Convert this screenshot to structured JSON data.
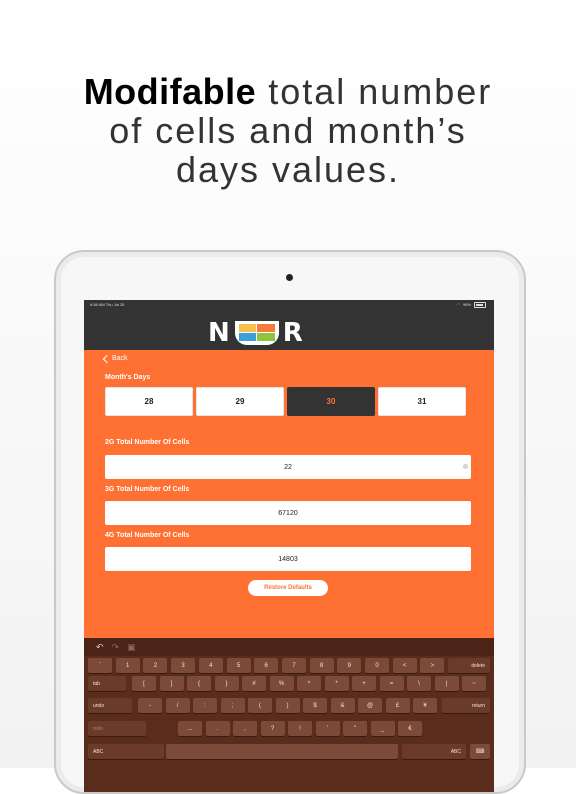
{
  "headline": {
    "bold": "Modifable",
    "rest_line1": " total number",
    "line2": "of cells and month’s",
    "line3": "days values."
  },
  "status_bar": {
    "time": "6:58 AM   Thu Jul 25",
    "battery": "96%"
  },
  "logo": {
    "letter1": "N",
    "letter3": "R",
    "u_colors": [
      "#f2c14e",
      "#f47b3b",
      "#3aa0d8",
      "#8cc63f"
    ]
  },
  "nav": {
    "back_label": "Back"
  },
  "month_days": {
    "label": "Month's Days",
    "options": [
      "28",
      "29",
      "30",
      "31"
    ],
    "selected": "30",
    "accent": "#ff7132"
  },
  "fields": [
    {
      "label": "2G Total Number Of Cells",
      "value": "22"
    },
    {
      "label": "3G Total Number Of Cells",
      "value": "67120"
    },
    {
      "label": "4G Total Number Of Cells",
      "value": "14803"
    }
  ],
  "restore_label": "Restore Defaults",
  "keyboard": {
    "toolbar": [
      "undo-icon",
      "redo-icon",
      "paste-icon"
    ],
    "row1": [
      "`",
      "1",
      "2",
      "3",
      "4",
      "5",
      "6",
      "7",
      "8",
      "9",
      "0",
      "<",
      ">",
      "delete"
    ],
    "row2": [
      "tab",
      "[",
      "]",
      "{",
      "}",
      "#",
      "%",
      "^",
      "*",
      "+",
      "=",
      "\\",
      "|",
      "~"
    ],
    "row3": [
      "undo",
      "-",
      "/",
      ":",
      ";",
      "(",
      ")",
      "$",
      "&",
      "@",
      "£",
      "¥",
      "return"
    ],
    "row4": [
      "redo",
      "...",
      ".",
      ",",
      "?",
      "!",
      "’",
      "\"",
      "_",
      "€"
    ],
    "row5": [
      "ABC",
      "",
      "ABC",
      "keyboard-icon"
    ]
  }
}
